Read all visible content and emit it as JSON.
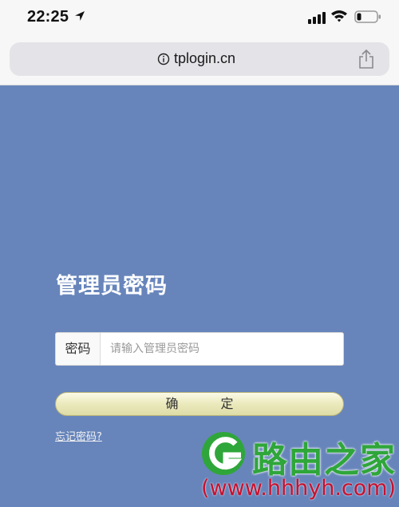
{
  "status_bar": {
    "time": "22:25"
  },
  "browser": {
    "url": "tplogin.cn"
  },
  "login": {
    "title": "管理员密码",
    "password_label": "密码",
    "password_placeholder": "请输入管理员密码",
    "password_value": "",
    "confirm_label": "确 定",
    "forgot_link": "忘记密码?"
  },
  "watermark": {
    "brand": "路由之家",
    "url": "(www.hhhyh.com)"
  },
  "colors": {
    "background": "#6785bb",
    "button": "#ecebbf",
    "watermark_green": "#2fa63a",
    "watermark_red": "#c8102e"
  }
}
